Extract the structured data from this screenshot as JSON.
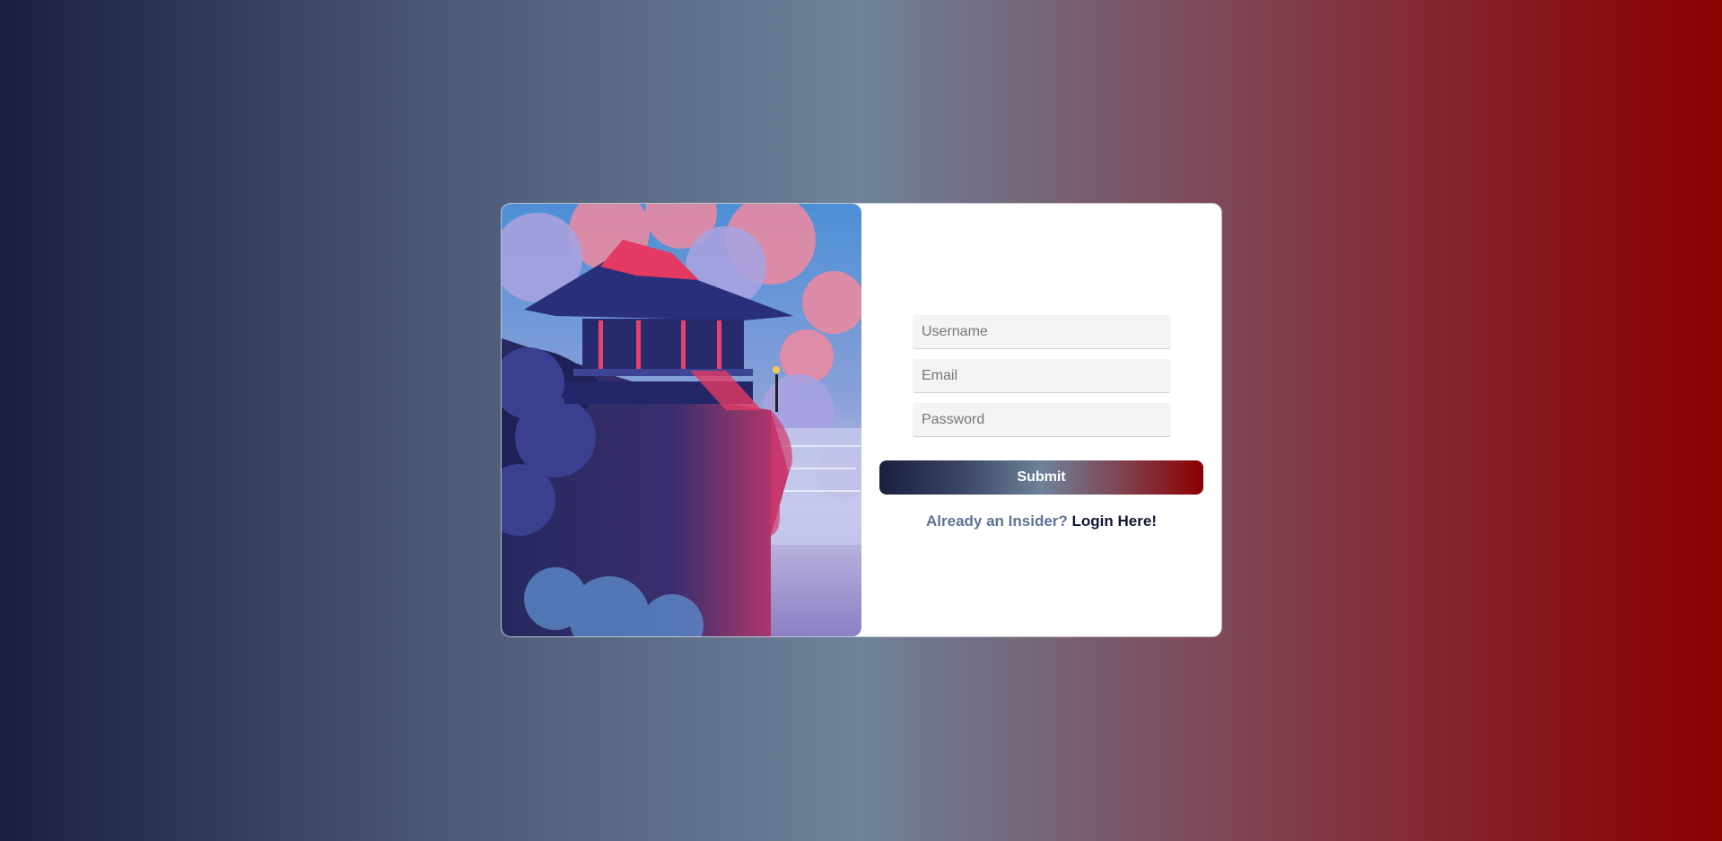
{
  "form": {
    "username_placeholder": "Username",
    "email_placeholder": "Email",
    "password_placeholder": "Password",
    "submit_label": "Submit",
    "login_prompt": "Already an Insider?",
    "login_link": "Login Here!"
  },
  "image": {
    "alt": "Pagoda on a cliff"
  },
  "colors": {
    "gradient_start": "#1b1f3f",
    "gradient_mid": "#6e8299",
    "gradient_end": "#8b0000",
    "link_prompt": "#5f7394",
    "link_text": "#141833"
  }
}
